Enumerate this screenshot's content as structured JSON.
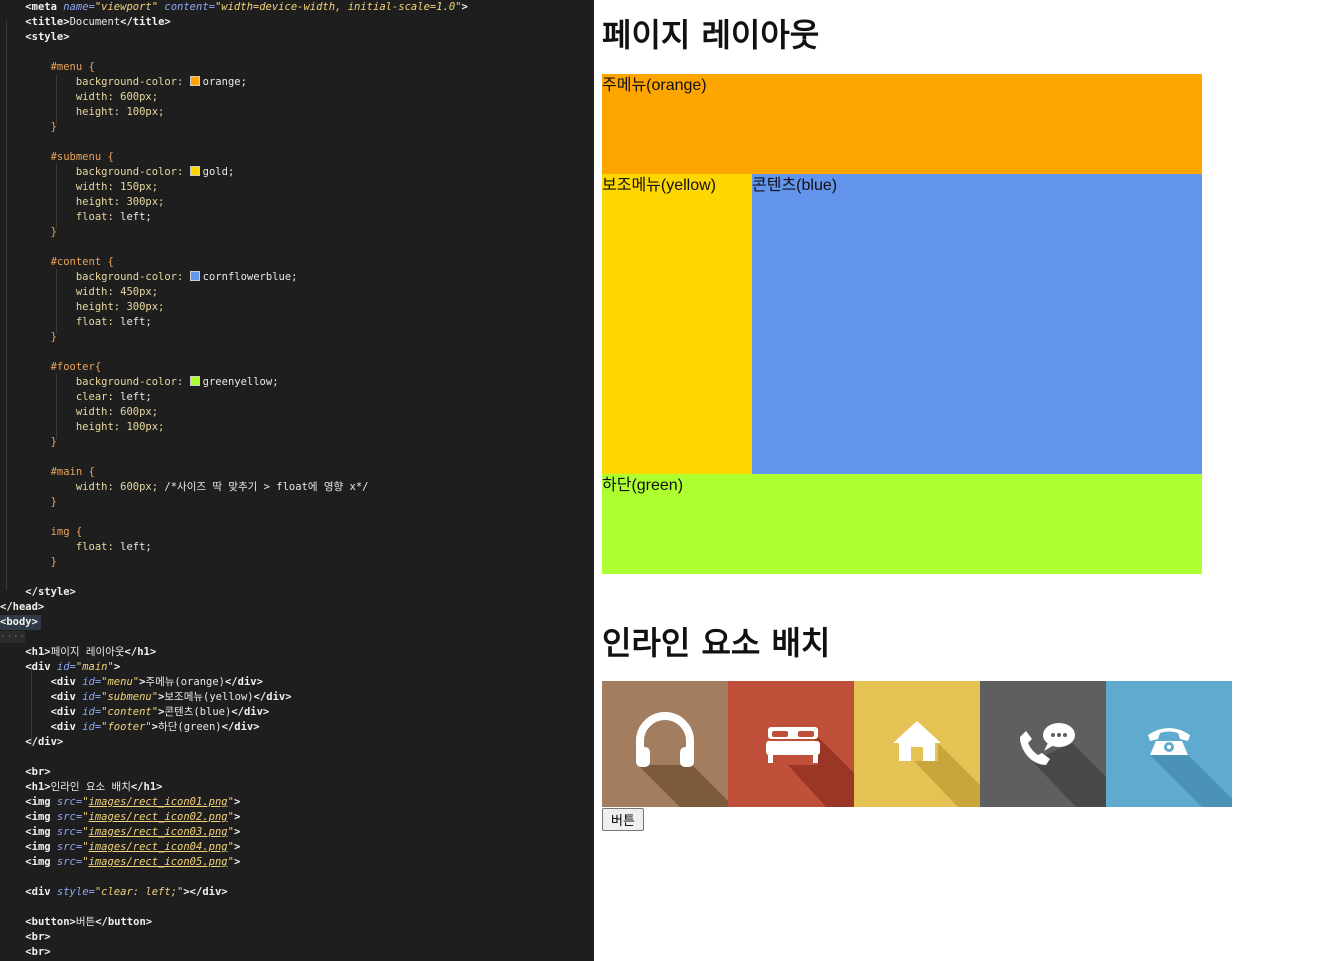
{
  "editor": {
    "lines": [
      [
        [
          "i",
          "    "
        ],
        [
          "tag",
          "<meta "
        ],
        [
          "attr",
          "name="
        ],
        [
          "str",
          "\"viewport\" "
        ],
        [
          "attr",
          "content="
        ],
        [
          "str",
          "\"width=device-width, initial-scale=1.0\""
        ],
        [
          "tag",
          ">"
        ]
      ],
      [
        [
          "i",
          "    "
        ],
        [
          "tag",
          "<title>"
        ],
        [
          "text",
          "Document"
        ],
        [
          "tag",
          "</title>"
        ]
      ],
      [
        [
          "i",
          "    "
        ],
        [
          "tag",
          "<style>"
        ]
      ],
      [],
      [
        [
          "i",
          "        "
        ],
        [
          "sel",
          "#menu {"
        ]
      ],
      [
        [
          "i",
          "            "
        ],
        [
          "prop",
          "background-color: "
        ],
        [
          "swatch",
          "#ffa500"
        ],
        [
          "val",
          "orange;"
        ]
      ],
      [
        [
          "i",
          "            "
        ],
        [
          "prop",
          "width: "
        ],
        [
          "num",
          "600px;"
        ]
      ],
      [
        [
          "i",
          "            "
        ],
        [
          "prop",
          "height: "
        ],
        [
          "num",
          "100px;"
        ]
      ],
      [
        [
          "i",
          "        "
        ],
        [
          "brace",
          "}"
        ]
      ],
      [],
      [
        [
          "i",
          "        "
        ],
        [
          "sel",
          "#submenu {"
        ]
      ],
      [
        [
          "i",
          "            "
        ],
        [
          "prop",
          "background-color: "
        ],
        [
          "swatch",
          "#ffd700"
        ],
        [
          "val",
          "gold;"
        ]
      ],
      [
        [
          "i",
          "            "
        ],
        [
          "prop",
          "width: "
        ],
        [
          "num",
          "150px;"
        ]
      ],
      [
        [
          "i",
          "            "
        ],
        [
          "prop",
          "height: "
        ],
        [
          "num",
          "300px;"
        ]
      ],
      [
        [
          "i",
          "            "
        ],
        [
          "prop",
          "float: "
        ],
        [
          "val",
          "left;"
        ]
      ],
      [
        [
          "i",
          "        "
        ],
        [
          "brace",
          "}"
        ]
      ],
      [],
      [
        [
          "i",
          "        "
        ],
        [
          "sel",
          "#content {"
        ]
      ],
      [
        [
          "i",
          "            "
        ],
        [
          "prop",
          "background-color: "
        ],
        [
          "swatch",
          "#6495ed"
        ],
        [
          "val",
          "cornflowerblue;"
        ]
      ],
      [
        [
          "i",
          "            "
        ],
        [
          "prop",
          "width: "
        ],
        [
          "num",
          "450px;"
        ]
      ],
      [
        [
          "i",
          "            "
        ],
        [
          "prop",
          "height: "
        ],
        [
          "num",
          "300px;"
        ]
      ],
      [
        [
          "i",
          "            "
        ],
        [
          "prop",
          "float: "
        ],
        [
          "val",
          "left;"
        ]
      ],
      [
        [
          "i",
          "        "
        ],
        [
          "brace",
          "}"
        ]
      ],
      [],
      [
        [
          "i",
          "        "
        ],
        [
          "sel",
          "#footer{"
        ]
      ],
      [
        [
          "i",
          "            "
        ],
        [
          "prop",
          "background-color: "
        ],
        [
          "swatch",
          "#adff2f"
        ],
        [
          "val",
          "greenyellow;"
        ]
      ],
      [
        [
          "i",
          "            "
        ],
        [
          "prop",
          "clear: "
        ],
        [
          "val",
          "left;"
        ]
      ],
      [
        [
          "i",
          "            "
        ],
        [
          "prop",
          "width: "
        ],
        [
          "num",
          "600px;"
        ]
      ],
      [
        [
          "i",
          "            "
        ],
        [
          "prop",
          "height: "
        ],
        [
          "num",
          "100px;"
        ]
      ],
      [
        [
          "i",
          "        "
        ],
        [
          "brace",
          "}"
        ]
      ],
      [],
      [
        [
          "i",
          "        "
        ],
        [
          "sel",
          "#main {"
        ]
      ],
      [
        [
          "i",
          "            "
        ],
        [
          "prop",
          "width: "
        ],
        [
          "num",
          "600px; "
        ],
        [
          "comment",
          "/*사이즈 딱 맞추기 > float에 영향 x*/"
        ]
      ],
      [
        [
          "i",
          "        "
        ],
        [
          "brace",
          "}"
        ]
      ],
      [],
      [
        [
          "i",
          "        "
        ],
        [
          "sel",
          "img {"
        ]
      ],
      [
        [
          "i",
          "            "
        ],
        [
          "prop",
          "float: "
        ],
        [
          "val",
          "left;"
        ]
      ],
      [
        [
          "i",
          "        "
        ],
        [
          "brace",
          "}"
        ]
      ],
      [],
      [
        [
          "i",
          "    "
        ],
        [
          "tag",
          "</style>"
        ]
      ],
      [
        [
          "tag",
          "</head>"
        ]
      ],
      [
        [
          "body",
          "<body>"
        ]
      ],
      [
        [
          "dots",
          "····"
        ]
      ],
      [
        [
          "i",
          "    "
        ],
        [
          "tag",
          "<h1>"
        ],
        [
          "text",
          "페이지 레이아웃"
        ],
        [
          "tag",
          "</h1>"
        ]
      ],
      [
        [
          "i",
          "    "
        ],
        [
          "tag",
          "<div "
        ],
        [
          "attr",
          "id="
        ],
        [
          "str",
          "\"main\""
        ],
        [
          "tag",
          ">"
        ]
      ],
      [
        [
          "i",
          "        "
        ],
        [
          "tag",
          "<div "
        ],
        [
          "attr",
          "id="
        ],
        [
          "str",
          "\"menu\""
        ],
        [
          "tag",
          ">"
        ],
        [
          "text",
          "주메뉴(orange)"
        ],
        [
          "tag",
          "</div>"
        ]
      ],
      [
        [
          "i",
          "        "
        ],
        [
          "tag",
          "<div "
        ],
        [
          "attr",
          "id="
        ],
        [
          "str",
          "\"submenu\""
        ],
        [
          "tag",
          ">"
        ],
        [
          "text",
          "보조메뉴(yellow)"
        ],
        [
          "tag",
          "</div>"
        ]
      ],
      [
        [
          "i",
          "        "
        ],
        [
          "tag",
          "<div "
        ],
        [
          "attr",
          "id="
        ],
        [
          "str",
          "\"content\""
        ],
        [
          "tag",
          ">"
        ],
        [
          "text",
          "콘텐츠(blue)"
        ],
        [
          "tag",
          "</div>"
        ]
      ],
      [
        [
          "i",
          "        "
        ],
        [
          "tag",
          "<div "
        ],
        [
          "attr",
          "id="
        ],
        [
          "str",
          "\"footer\""
        ],
        [
          "tag",
          ">"
        ],
        [
          "text",
          "하단(green)"
        ],
        [
          "tag",
          "</div>"
        ]
      ],
      [
        [
          "i",
          "    "
        ],
        [
          "tag",
          "</div>"
        ]
      ],
      [],
      [
        [
          "i",
          "    "
        ],
        [
          "tag",
          "<br>"
        ]
      ],
      [
        [
          "i",
          "    "
        ],
        [
          "tag",
          "<h1>"
        ],
        [
          "text",
          "인라인 요소 배치"
        ],
        [
          "tag",
          "</h1>"
        ]
      ],
      [
        [
          "i",
          "    "
        ],
        [
          "tag",
          "<img "
        ],
        [
          "attr",
          "src="
        ],
        [
          "str",
          "\""
        ],
        [
          "link",
          "images/rect_icon01.png"
        ],
        [
          "str",
          "\""
        ],
        [
          "tag",
          ">"
        ]
      ],
      [
        [
          "i",
          "    "
        ],
        [
          "tag",
          "<img "
        ],
        [
          "attr",
          "src="
        ],
        [
          "str",
          "\""
        ],
        [
          "link",
          "images/rect_icon02.png"
        ],
        [
          "str",
          "\""
        ],
        [
          "tag",
          ">"
        ]
      ],
      [
        [
          "i",
          "    "
        ],
        [
          "tag",
          "<img "
        ],
        [
          "attr",
          "src="
        ],
        [
          "str",
          "\""
        ],
        [
          "link",
          "images/rect_icon03.png"
        ],
        [
          "str",
          "\""
        ],
        [
          "tag",
          ">"
        ]
      ],
      [
        [
          "i",
          "    "
        ],
        [
          "tag",
          "<img "
        ],
        [
          "attr",
          "src="
        ],
        [
          "str",
          "\""
        ],
        [
          "link",
          "images/rect_icon04.png"
        ],
        [
          "str",
          "\""
        ],
        [
          "tag",
          ">"
        ]
      ],
      [
        [
          "i",
          "    "
        ],
        [
          "tag",
          "<img "
        ],
        [
          "attr",
          "src="
        ],
        [
          "str",
          "\""
        ],
        [
          "link",
          "images/rect_icon05.png"
        ],
        [
          "str",
          "\""
        ],
        [
          "tag",
          ">"
        ]
      ],
      [],
      [
        [
          "i",
          "    "
        ],
        [
          "tag",
          "<div "
        ],
        [
          "attr",
          "style="
        ],
        [
          "str",
          "\"clear: left;\""
        ],
        [
          "tag",
          "></div>"
        ]
      ],
      [],
      [
        [
          "i",
          "    "
        ],
        [
          "tag",
          "<button>"
        ],
        [
          "text",
          "버튼"
        ],
        [
          "tag",
          "</button>"
        ]
      ],
      [
        [
          "i",
          "    "
        ],
        [
          "tag",
          "<br>"
        ]
      ],
      [
        [
          "i",
          "    "
        ],
        [
          "tag",
          "<br>"
        ]
      ]
    ]
  },
  "preview": {
    "heading1": "페이지 레이아웃",
    "menu_label": "주메뉴(orange)",
    "submenu_label": "보조메뉴(yellow)",
    "content_label": "콘텐츠(blue)",
    "footer_label": "하단(green)",
    "heading2": "인라인 요소 배치",
    "button_label": "버튼",
    "colors": {
      "menu": "#ffa500",
      "submenu": "#ffd700",
      "content": "#6495ed",
      "footer": "#adff2f"
    },
    "icons": [
      {
        "name": "headphones-icon",
        "bg": "#a27d5f",
        "shadow": "#7d5a3c"
      },
      {
        "name": "bed-icon",
        "bg": "#c0503a",
        "shadow": "#9a3626"
      },
      {
        "name": "home-icon",
        "bg": "#e4c253",
        "shadow": "#c9a63b"
      },
      {
        "name": "phone-chat-icon",
        "bg": "#5f5f5f",
        "shadow": "#484848"
      },
      {
        "name": "telephone-icon",
        "bg": "#5faacf",
        "shadow": "#4a92b6"
      }
    ]
  }
}
